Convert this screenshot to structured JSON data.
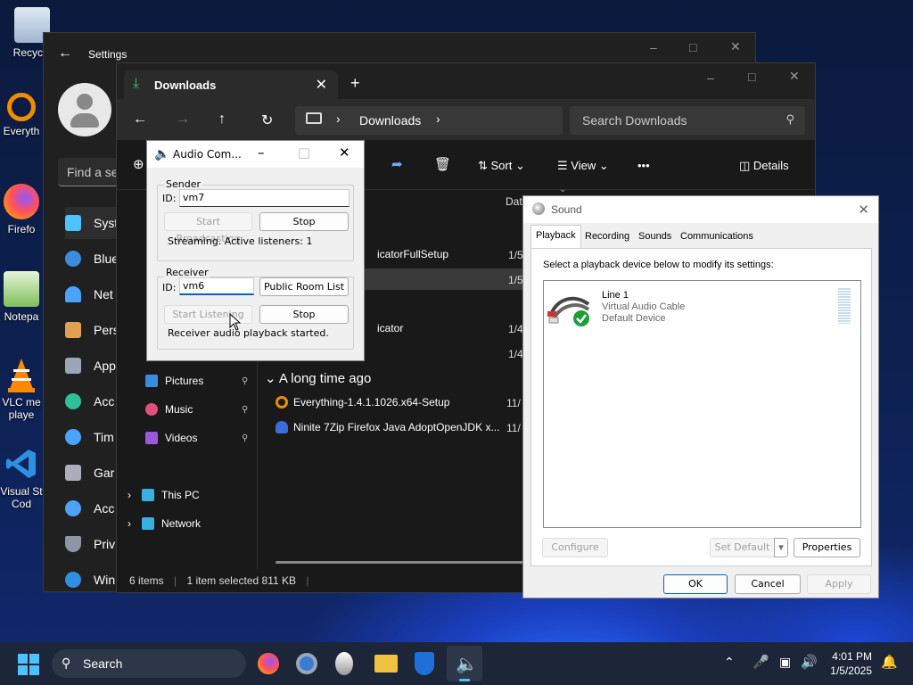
{
  "desktop": {
    "icons": [
      {
        "label": "Recycle",
        "icon": "recycle-bin-icon"
      },
      {
        "label": "Everyth",
        "icon": "everything-search-icon"
      },
      {
        "label": "Firefo",
        "icon": "firefox-icon"
      },
      {
        "label": "Notepa",
        "icon": "notepad-icon"
      },
      {
        "label": "VLC me\nplaye",
        "icon": "vlc-icon"
      },
      {
        "label": "Visual St\nCod",
        "icon": "vscode-icon"
      }
    ]
  },
  "settings": {
    "title": "Settings",
    "search_placeholder": "Find a se",
    "nav": [
      "Syst",
      "Blue",
      "Net",
      "Pers",
      "App",
      "Acc",
      "Tim",
      "Gar",
      "Acc",
      "Priv",
      "Win"
    ]
  },
  "explorer": {
    "tab_title": "Downloads",
    "breadcrumb": "Downloads",
    "search_placeholder": "Search Downloads",
    "toolbar": {
      "sort": "Sort",
      "view": "View",
      "more": "•••",
      "details": "Details"
    },
    "column_header": "Dat",
    "sidebar": {
      "quick": [
        {
          "label": "Pictures",
          "icon": "pictures-icon"
        },
        {
          "label": "Music",
          "icon": "music-icon"
        },
        {
          "label": "Videos",
          "icon": "videos-icon"
        }
      ],
      "this_pc": "This PC",
      "network": "Network"
    },
    "files_top": [
      {
        "name": "icatorFullSetup",
        "date": "1/5"
      },
      {
        "name": "",
        "date": "1/5"
      },
      {
        "name": "icator",
        "date": "1/4"
      },
      {
        "name": "",
        "date": "1/4"
      }
    ],
    "group_long_ago": "A long time ago",
    "files_old": [
      {
        "name": "Everything-1.4.1.1026.x64-Setup",
        "date": "11/"
      },
      {
        "name": "Ninite 7Zip Firefox Java AdoptOpenJDK x...",
        "date": "11/"
      }
    ],
    "status": {
      "count": "6 items",
      "selected": "1 item selected  811 KB"
    }
  },
  "audio": {
    "title": "Audio Com...",
    "sender": {
      "group": "Sender",
      "id_label": "ID:",
      "id_value": "vm7",
      "start_label": "Start Broadcasting",
      "stop_label": "Stop",
      "status": "Streaming. Active listeners: 1"
    },
    "receiver": {
      "group": "Receiver",
      "id_label": "ID:",
      "id_value": "vm6",
      "public_rooms": "Public Room List",
      "start_label": "Start Listening",
      "stop_label": "Stop",
      "status": "Receiver audio playback started."
    }
  },
  "sound": {
    "title": "Sound",
    "tabs": [
      "Playback",
      "Recording",
      "Sounds",
      "Communications"
    ],
    "instruction": "Select a playback device below to modify its settings:",
    "device": {
      "name": "Line 1",
      "desc": "Virtual Audio Cable",
      "status": "Default Device",
      "level": 0
    },
    "buttons": {
      "configure": "Configure",
      "set_default": "Set Default",
      "properties": "Properties",
      "ok": "OK",
      "cancel": "Cancel",
      "apply": "Apply"
    }
  },
  "taskbar": {
    "search": "Search",
    "time": "4:01 PM",
    "date": "1/5/2025"
  }
}
